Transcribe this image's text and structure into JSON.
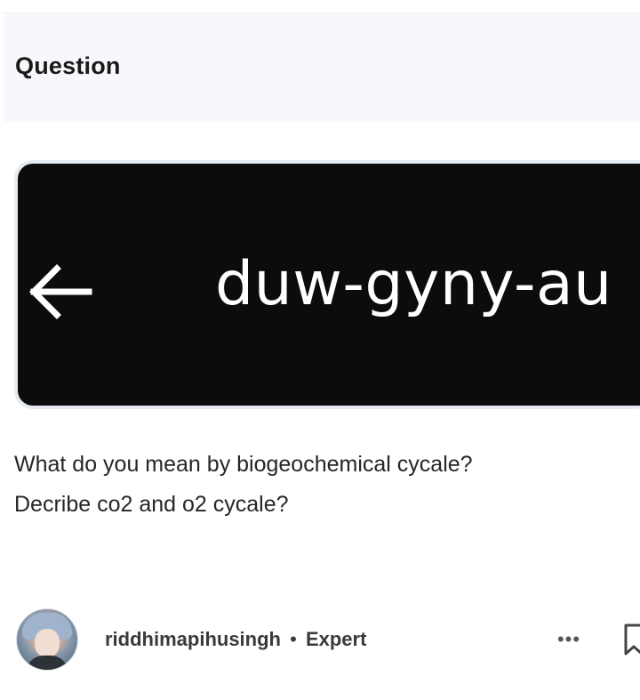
{
  "question_section": {
    "title": "Question"
  },
  "attached_image": {
    "url_text": "duw-gyny-au",
    "back_icon": "arrow-left-icon"
  },
  "question": {
    "line1": "What do you mean by biogeochemical cycale?",
    "line2": "Decribe co2 and o2 cycale?"
  },
  "author": {
    "username": "riddhimapihusingh",
    "separator": "•",
    "badge": "Expert",
    "avatar_icon": "user-avatar"
  },
  "actions": {
    "more_label": "•••",
    "more_icon": "more-options-icon",
    "bookmark_icon": "bookmark-icon"
  },
  "colors": {
    "header_bg": "#f6f8fb",
    "image_bg": "#0c0c0c",
    "text": "#262626"
  }
}
